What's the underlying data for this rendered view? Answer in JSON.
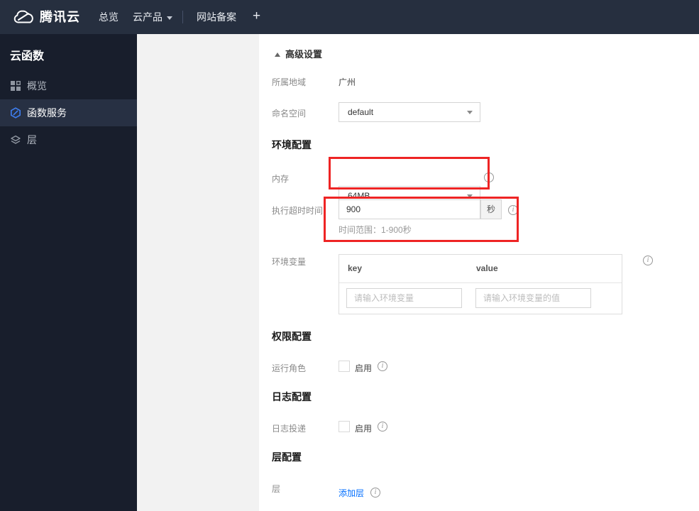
{
  "nav": {
    "brand": "腾讯云",
    "overview": "总览",
    "products": "云产品",
    "icp": "网站备案",
    "add": "+"
  },
  "sidebar": {
    "title": "云函数",
    "items": [
      {
        "label": "概览",
        "icon": "grid-icon",
        "active": false
      },
      {
        "label": "函数服务",
        "icon": "scf-hexagon-icon",
        "active": true
      },
      {
        "label": "层",
        "icon": "layers-icon",
        "active": false
      }
    ]
  },
  "content": {
    "advanced_settings": "高级设置",
    "region_label": "所属地域",
    "region_value": "广州",
    "namespace_label": "命名空间",
    "namespace_value": "default",
    "env_config_title": "环境配置",
    "memory_label": "内存",
    "memory_value": "64MB",
    "timeout_label": "执行超时时间",
    "timeout_value": "900",
    "timeout_unit": "秒",
    "timeout_hint": "时间范围：1-900秒",
    "envvar_label": "环境变量",
    "envvar_key_header": "key",
    "envvar_value_header": "value",
    "envvar_key_placeholder": "请输入环境变量",
    "envvar_value_placeholder": "请输入环境变量的值",
    "perm_config_title": "权限配置",
    "role_label": "运行角色",
    "role_enable_label": "启用",
    "log_config_title": "日志配置",
    "log_label": "日志投递",
    "log_enable_label": "启用",
    "layer_config_title": "层配置",
    "layer_label": "层",
    "add_layer_link": "添加层"
  },
  "colors": {
    "nav_bg": "#262f3f",
    "sidebar_bg": "#181e2c",
    "sidebar_active_bg": "#273043",
    "panel_gray": "#f2f2f2",
    "highlight_red": "#ee2424",
    "link_blue": "#006eff",
    "scf_icon_blue": "#3f7ff2"
  }
}
